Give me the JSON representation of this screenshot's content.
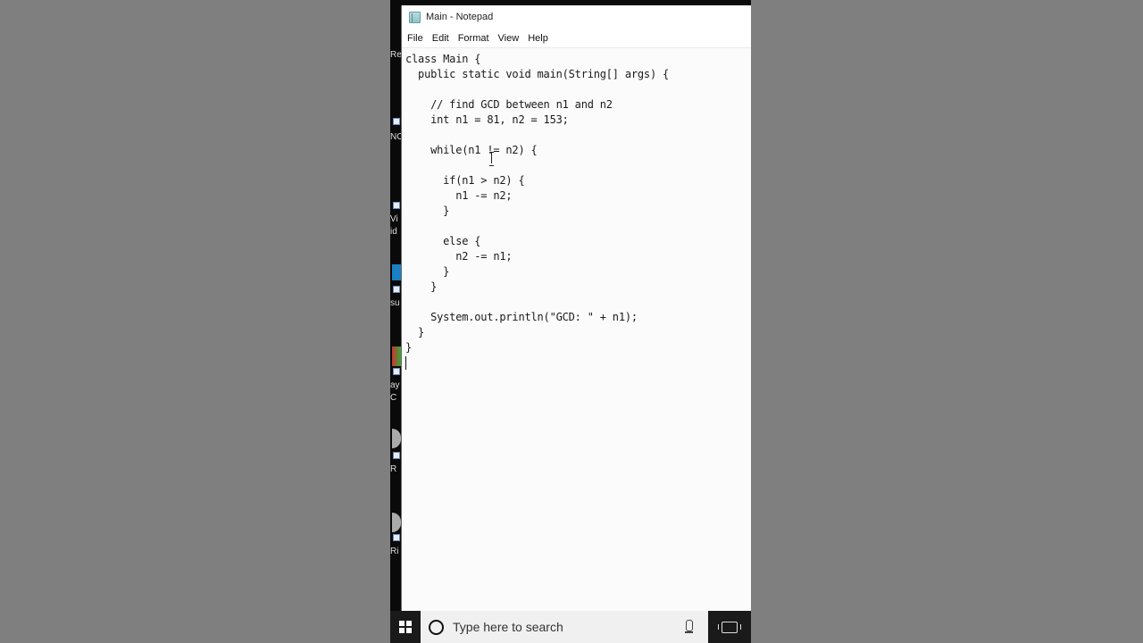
{
  "window": {
    "title": "Main - Notepad",
    "app_icon": "notepad-icon"
  },
  "menu": [
    "File",
    "Edit",
    "Format",
    "View",
    "Help"
  ],
  "editor": {
    "lines": [
      "class Main {",
      "  public static void main(String[] args) {",
      "",
      "    // find GCD between n1 and n2",
      "    int n1 = 81, n2 = 153;",
      "",
      "    while(n1 != n2) {",
      "",
      "      if(n1 > n2) {",
      "        n1 -= n2;",
      "      }",
      "",
      "      else {",
      "        n2 -= n1;",
      "      }",
      "    }",
      "",
      "    System.out.println(\"GCD: \" + n1);",
      "  }",
      "}",
      ""
    ]
  },
  "desktop": {
    "labels": [
      "Re",
      "NC",
      "Vi",
      "id",
      "su",
      "ay",
      "C",
      "R",
      "Ri"
    ]
  },
  "taskbar": {
    "start_icon": "windows-logo-icon",
    "search_placeholder": "Type here to search",
    "search_icon": "cortana-circle-icon",
    "mic_icon": "microphone-icon",
    "taskview_icon": "task-view-icon"
  }
}
